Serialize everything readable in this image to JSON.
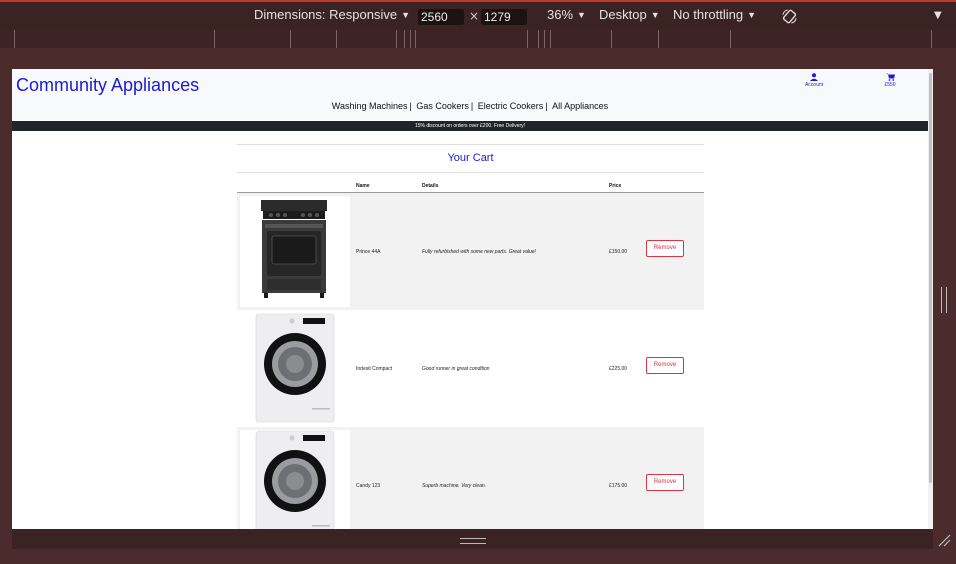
{
  "devtools": {
    "dimensions_label": "Dimensions: Responsive",
    "width": "2560",
    "times": "×",
    "height": "1279",
    "zoom": "36%",
    "device": "Desktop",
    "throttling": "No throttling"
  },
  "site": {
    "brand": "Community Appliances",
    "account_label": "Account",
    "cart_total": "£550",
    "nav": [
      "Washing Machines",
      "|",
      "Gas Cookers",
      "|",
      "Electric Cookers",
      "|",
      "All Appliances"
    ],
    "promo": "15% discount on orders over £200. Free Delivery!"
  },
  "cart": {
    "title": "Your Cart",
    "headers": {
      "name": "Name",
      "details": "Details",
      "price": "Price"
    },
    "remove_label": "Remove",
    "rows": [
      {
        "name": "Prince 44A",
        "details": "Fully refurbished with some new parts. Great value!",
        "price": "£150.00",
        "image": "range-cooker"
      },
      {
        "name": "Indesit Compact",
        "details": "Good runner in great condition",
        "price": "£225.00",
        "image": "washing-machine"
      },
      {
        "name": "Candy 123",
        "details": "Superb machine. Very clean.",
        "price": "£175.00",
        "image": "washing-machine"
      }
    ]
  },
  "colors": {
    "brand": "#1a1ad8",
    "danger": "#dc3545",
    "promo_bg": "#212529"
  }
}
